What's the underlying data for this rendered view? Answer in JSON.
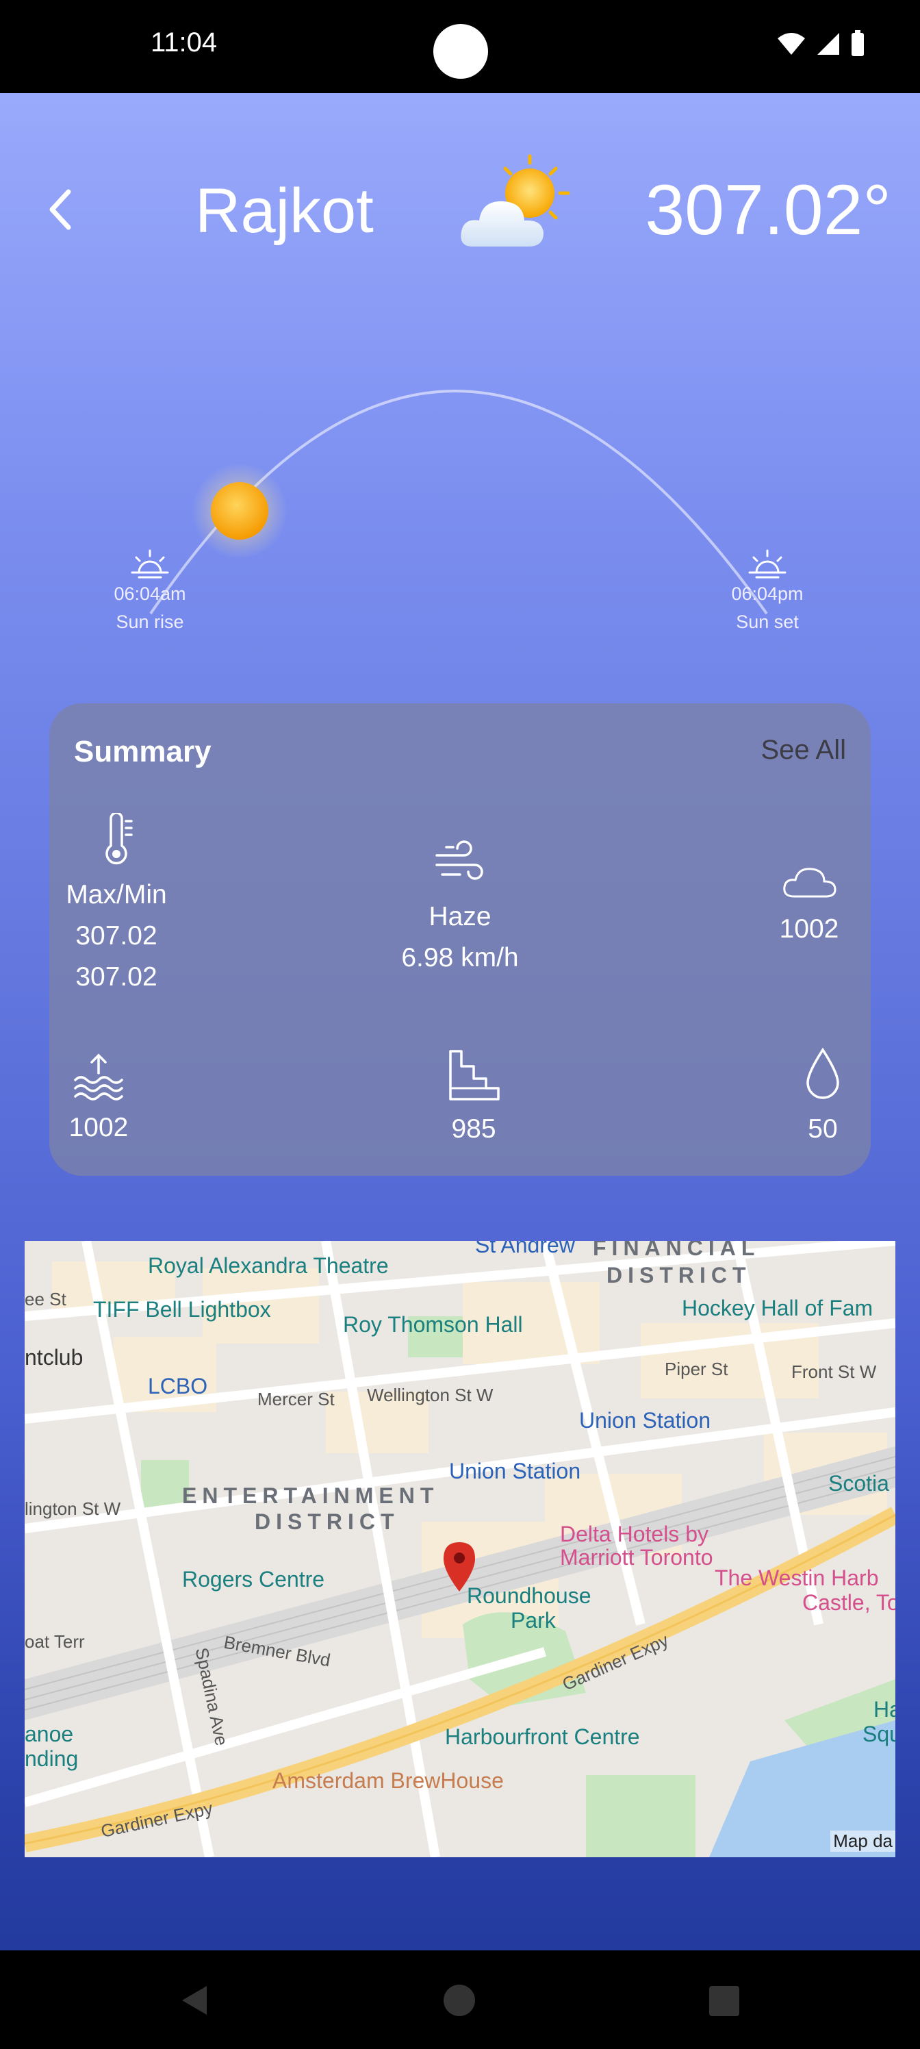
{
  "status_bar": {
    "time": "11:04"
  },
  "header": {
    "city": "Rajkot",
    "temperature": "307.02°",
    "weather_icon": "partly-cloudy-sun-icon"
  },
  "sun": {
    "sunrise_time": "06:04am",
    "sunrise_label": "Sun rise",
    "sunset_time": "06:04pm",
    "sunset_label": "Sun set"
  },
  "summary": {
    "title": "Summary",
    "see_all": "See All",
    "maxmin_label": "Max/Min",
    "max": "307.02",
    "min": "307.02",
    "condition": "Haze",
    "wind": "6.98 km/h",
    "clouds": "1002",
    "sea_level": "1002",
    "ground_level": "985",
    "humidity": "50"
  },
  "map": {
    "labels": {
      "royal_alexandra": "Royal Alexandra Theatre",
      "st_andrew": "St Andrew",
      "financial_district_1": "FINANCIAL",
      "financial_district_2": "DISTRICT",
      "tiff": "TIFF Bell Lightbox",
      "roy_thomson": "Roy Thomson Hall",
      "hockey_hall": "Hockey Hall of Fam",
      "ntclub": "ntclub",
      "lcbo": "LCBO",
      "mercer": "Mercer St",
      "wellington": "Wellington St W",
      "piper": "Piper St",
      "front": "Front St W",
      "union_station_1": "Union Station",
      "union_station_2": "Union Station",
      "wellington_w": "lington St W",
      "entertainment_1": "ENTERTAINMENT",
      "entertainment_2": "DISTRICT",
      "scotia": "Scotia",
      "delta_1": "Delta Hotels by",
      "delta_2": "Marriott Toronto",
      "westin_1": "The Westin Harb",
      "westin_2": "Castle, Toro",
      "rogers": "Rogers Centre",
      "roundhouse_1": "Roundhouse",
      "roundhouse_2": "Park",
      "boat_terr": "oat Terr",
      "bremner": "Bremner Blvd",
      "spadina": "Spadina Ave",
      "gardiner_1": "Gardiner Expy",
      "gardiner_2": "Gardiner Expy",
      "harbourfront": "Harbourfront Centre",
      "ha_squ_1": "Ha",
      "ha_squ_2": "Squ",
      "canoe_1": "anoe",
      "canoe_2": "nding",
      "amsterdam": "Amsterdam BrewHouse",
      "map_data": "Map da",
      "ee_st": "ee St"
    }
  },
  "colors": {
    "accent_marker": "#d93025",
    "summary_bg": "#7a82aa"
  }
}
